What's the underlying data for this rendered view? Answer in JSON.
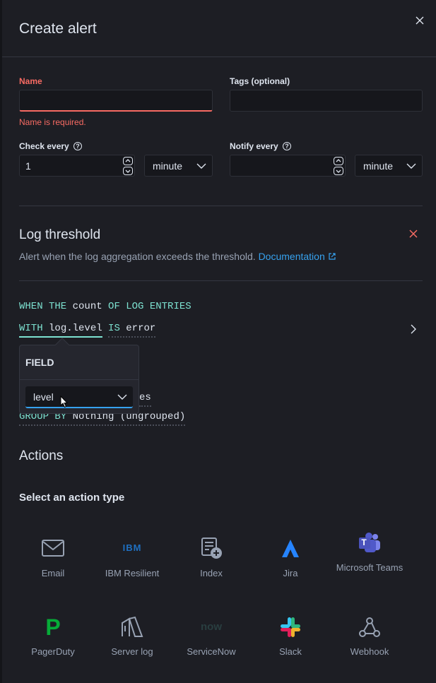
{
  "header": {
    "title": "Create alert"
  },
  "name_field": {
    "label": "Name",
    "value": "",
    "error": "Name is required."
  },
  "tags_field": {
    "label": "Tags (optional)",
    "value": ""
  },
  "check_every": {
    "label": "Check every",
    "value": "1",
    "unit": "minute"
  },
  "notify_every": {
    "label": "Notify every",
    "value": "",
    "unit": "minute"
  },
  "help_glyph": "?",
  "threshold": {
    "title": "Log threshold",
    "description": "Alert when the log aggregation exceeds the threshold.",
    "doc_link": "Documentation",
    "line1": {
      "kw1": "WHEN THE",
      "val1": "count",
      "kw2": "OF LOG ENTRIES"
    },
    "line2": {
      "kw1": "WITH",
      "val1": "log.level",
      "kw2": "IS",
      "val2": "error"
    },
    "line3_visible_tail": "es",
    "line4": {
      "kw1": "GROUP BY",
      "val1": "Nothing (ungrouped)"
    }
  },
  "popover": {
    "header": "FIELD",
    "selected": "level"
  },
  "actions": {
    "title": "Actions",
    "subtitle": "Select an action type",
    "types": [
      {
        "label": "Email",
        "icon": "mail-icon"
      },
      {
        "label": "IBM Resilient",
        "icon": "ibm-icon",
        "glyph": "IBM"
      },
      {
        "label": "Index",
        "icon": "index-icon"
      },
      {
        "label": "Jira",
        "icon": "jira-icon"
      },
      {
        "label": "Microsoft Teams",
        "icon": "teams-icon",
        "glyph": "T"
      },
      {
        "label": "PagerDuty",
        "icon": "pagerduty-icon",
        "glyph": "P"
      },
      {
        "label": "Server log",
        "icon": "server-log-icon"
      },
      {
        "label": "ServiceNow",
        "icon": "servicenow-icon",
        "glyph": "now"
      },
      {
        "label": "Slack",
        "icon": "slack-icon"
      },
      {
        "label": "Webhook",
        "icon": "webhook-icon"
      }
    ]
  },
  "colors": {
    "accent": "#36a2ef",
    "danger": "#f86b63",
    "keyword": "#7de2d1",
    "background": "#1d1e24"
  }
}
